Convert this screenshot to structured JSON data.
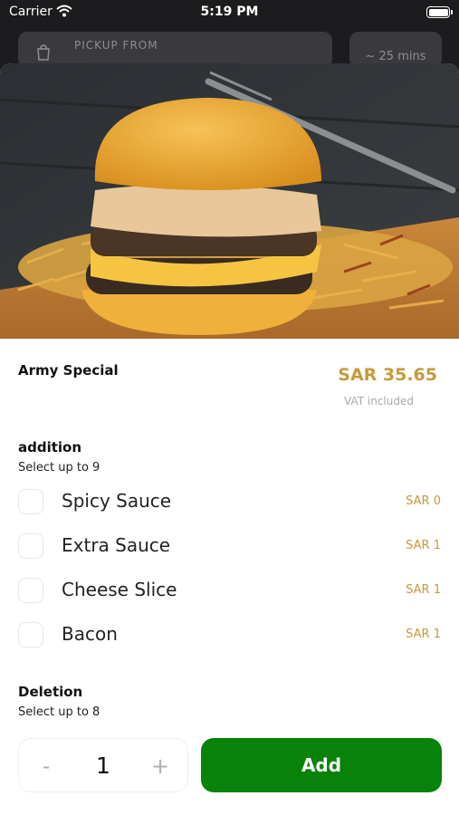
{
  "status_bar": {
    "carrier": "Carrier",
    "time": "5:19 PM"
  },
  "header": {
    "pickup_label": "PICKUP FROM",
    "eta": "~ 25 mins"
  },
  "item": {
    "name": "Army Special",
    "price": "SAR 35.65",
    "vat_note": "VAT included"
  },
  "addition": {
    "title": "addition",
    "subtitle": "Select up to 9",
    "options": [
      {
        "label": "Spicy Sauce",
        "price": "SAR 0"
      },
      {
        "label": "Extra Sauce",
        "price": "SAR 1"
      },
      {
        "label": "Cheese Slice",
        "price": "SAR 1"
      },
      {
        "label": "Bacon",
        "price": "SAR 1"
      }
    ]
  },
  "deletion": {
    "title": "Deletion",
    "subtitle": "Select up to 8"
  },
  "cart": {
    "minus": "-",
    "quantity": "1",
    "plus": "+",
    "add_label": "Add"
  },
  "colors": {
    "accent": "#c69a3c",
    "add_button": "#098209",
    "header_bg": "#1c1c1e"
  }
}
